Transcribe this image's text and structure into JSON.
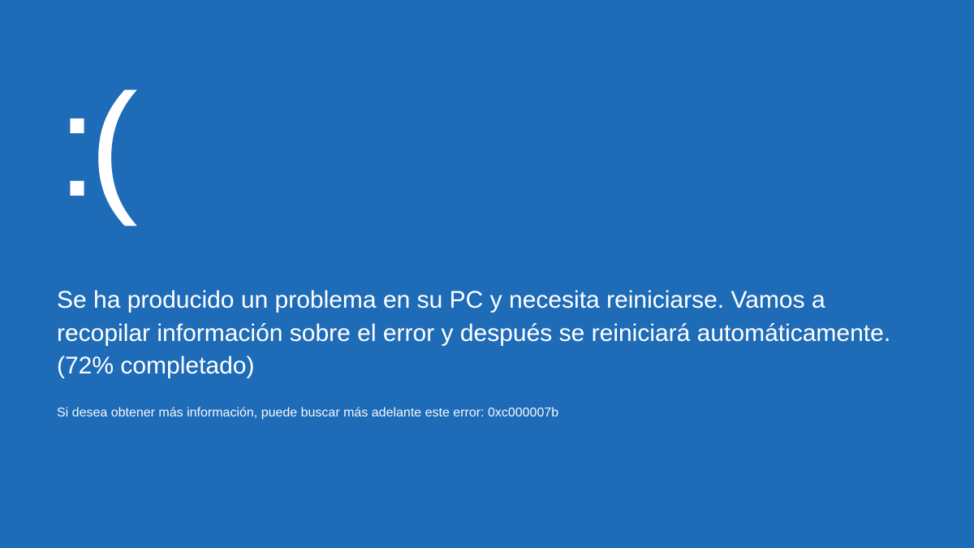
{
  "bsod": {
    "sad_face": ":(",
    "main_message": "Se ha producido un problema en su PC y necesita reiniciarse. Vamos a recopilar información sobre el error y después se reiniciará automáticamente. (72% completado)",
    "detail_message": "Si desea obtener más información, puede buscar más adelante este error: 0xc000007b",
    "progress_percent": 72,
    "error_code": "0xc000007b",
    "background_color": "#1e6bb8",
    "text_color": "#ffffff"
  }
}
